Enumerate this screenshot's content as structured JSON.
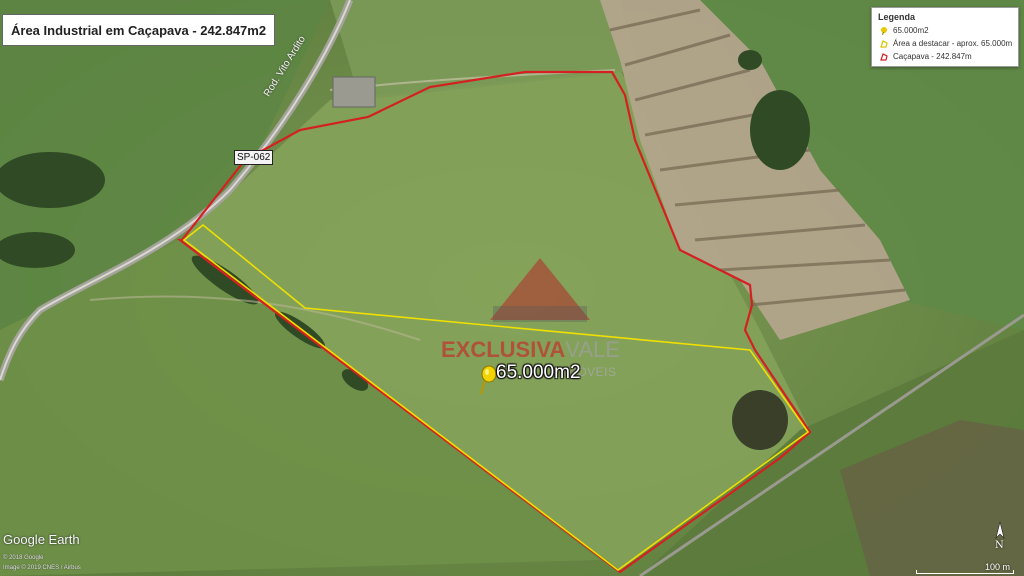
{
  "title": "Área Industrial em Caçapava - 242.847m2",
  "legend": {
    "heading": "Legenda",
    "items": [
      {
        "label": "65.000m2",
        "icon": "pushpin-icon",
        "color": "#e6c700"
      },
      {
        "label": "Área a destacar - aprox. 65.000m",
        "icon": "polygon-yellow-icon",
        "color": "#f0e000"
      },
      {
        "label": "Caçapava - 242.847m",
        "icon": "polygon-red-icon",
        "color": "#d42020"
      }
    ]
  },
  "road": {
    "shield": "SP-062",
    "name": "Rod. Vito Ardito"
  },
  "placemark": {
    "label": "65.000m2"
  },
  "watermark": {
    "brand_part1": "EXCLUSIVA",
    "brand_part2": "VALE",
    "sub": "IMÓVEIS"
  },
  "footer": {
    "logo": "Google Earth",
    "credit1": "© 2018 Google",
    "credit2": "Image © 2019 CNES / Airbus",
    "north": "N",
    "scale": "100 m"
  },
  "colors": {
    "boundary_total": "#d42020",
    "boundary_highlight": "#f0e000"
  }
}
